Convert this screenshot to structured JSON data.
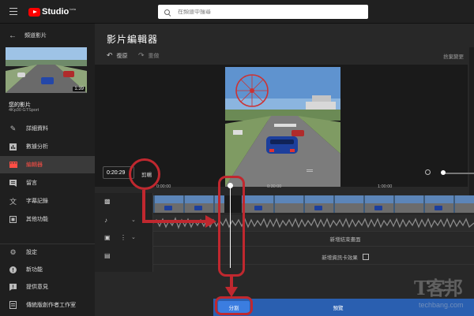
{
  "header": {
    "logo_text": "Studio",
    "logo_beta": "beta",
    "search_placeholder": "在頻道中搜尋"
  },
  "sidebar": {
    "back_label": "頻道影片",
    "thumbnail_duration": "1:39",
    "video_label": "您的影片",
    "video_title": "4Kp30 GTSport",
    "items": [
      {
        "label": "詳細資料",
        "icon": "pencil-icon"
      },
      {
        "label": "數據分析",
        "icon": "analytics-icon"
      },
      {
        "label": "編輯器",
        "icon": "editor-icon",
        "active": true
      },
      {
        "label": "留言",
        "icon": "comments-icon"
      },
      {
        "label": "字幕記錄",
        "icon": "translate-icon"
      },
      {
        "label": "其他功能",
        "icon": "more-features-icon"
      }
    ],
    "bottom_items": [
      {
        "label": "設定",
        "icon": "gear-icon"
      },
      {
        "label": "新功能",
        "icon": "whats-new-icon"
      },
      {
        "label": "提供意見",
        "icon": "feedback-icon"
      },
      {
        "label": "傳統版創作者工作室",
        "icon": "classic-studio-icon"
      }
    ]
  },
  "editor": {
    "title": "影片編輯器",
    "undo_label": "復原",
    "redo_label": "重做",
    "discard_label": "捨棄變更",
    "timecode": "0:20:29",
    "trim_label": "剪輯",
    "ruler_ticks": [
      "0:00:00",
      "0:30:00",
      "1:00:00"
    ],
    "endscreen_label": "新增結束畫面",
    "info_cards_label": "新增資訊卡效果",
    "split_button": "分割",
    "preview_button": "預覽"
  },
  "watermark": {
    "text": "T客邦",
    "sub": "techbang.com"
  },
  "colors": {
    "accent_red": "#c0282f",
    "brand_red": "#ff0000",
    "button_blue": "#3b7de0",
    "active_nav": "#ff4e45"
  }
}
